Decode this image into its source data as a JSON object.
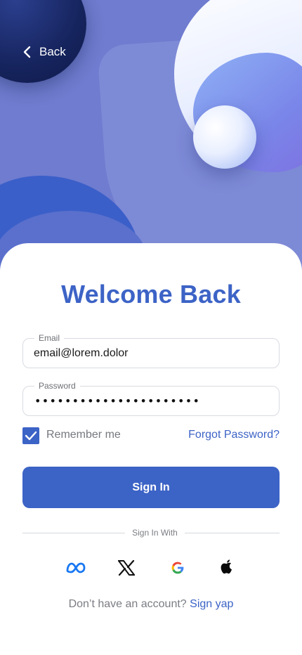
{
  "header": {
    "back_label": "Back"
  },
  "main": {
    "title": "Welcome Back",
    "email": {
      "label": "Email",
      "value": "email@lorem.dolor"
    },
    "password": {
      "label": "Password",
      "masked_value": "••••••••••••••••••••••"
    },
    "remember": {
      "label": "Remember me",
      "checked": true
    },
    "forgot_label": "Forgot Password?",
    "signin_label": "Sign In",
    "divider_label": "Sign In With",
    "social": [
      {
        "name": "meta-icon"
      },
      {
        "name": "x-icon"
      },
      {
        "name": "google-icon"
      },
      {
        "name": "apple-icon"
      }
    ],
    "signup_prompt": "Don’t have an account?",
    "signup_link": "Sign yap"
  },
  "colors": {
    "accent": "#3c63c6",
    "hero_background": "#6f7ccf",
    "back_circle": "#16245e"
  }
}
